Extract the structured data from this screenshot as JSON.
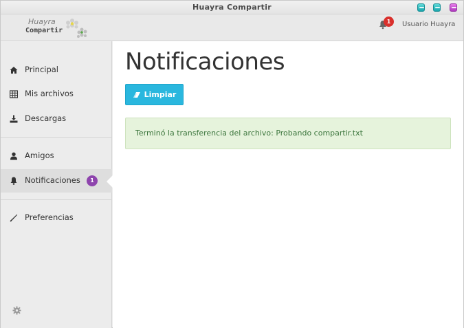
{
  "window": {
    "title": "Huayra Compartir"
  },
  "header": {
    "logo_line1": "Huayra",
    "logo_line2": "Compartir",
    "notification_count": "1",
    "username": "Usuario Huayra"
  },
  "sidebar": {
    "items": [
      {
        "label": "Principal",
        "icon": "home-icon"
      },
      {
        "label": "Mis archivos",
        "icon": "table-icon"
      },
      {
        "label": "Descargas",
        "icon": "download-icon"
      },
      {
        "label": "Amigos",
        "icon": "user-icon"
      },
      {
        "label": "Notificaciones",
        "icon": "bell-icon",
        "badge": "1",
        "active": true
      },
      {
        "label": "Preferencias",
        "icon": "wrench-icon"
      }
    ]
  },
  "main": {
    "title": "Notificaciones",
    "clear_label": "Limpiar",
    "notifications": [
      {
        "message": "Terminó la transferencia del archivo: Probando compartir.txt"
      }
    ]
  },
  "colors": {
    "accent": "#2ab7de",
    "badge_purple": "#8e44ad",
    "badge_red": "#d9302c",
    "alert_bg": "#e6f3dc",
    "alert_text": "#3c763d"
  }
}
